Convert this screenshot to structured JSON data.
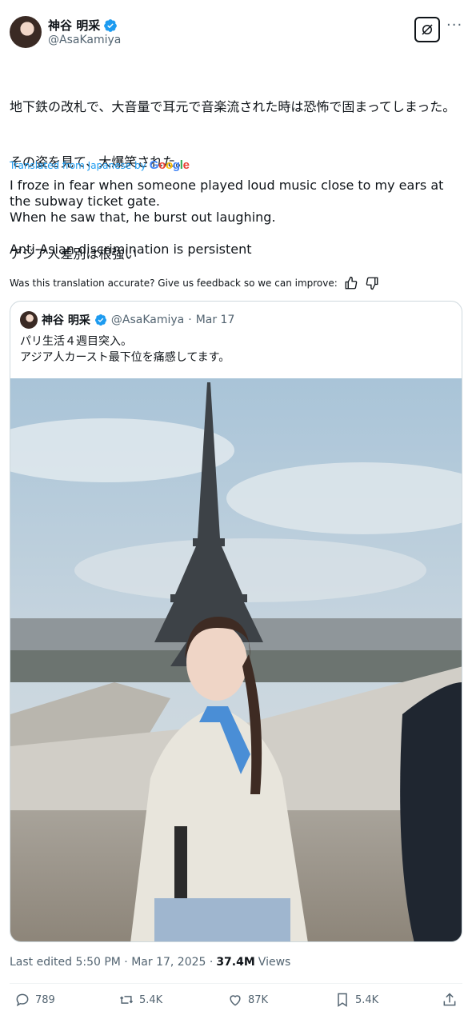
{
  "author": {
    "display_name": "神谷 明采",
    "handle": "@AsaKamiya"
  },
  "post": {
    "text_jp": [
      "地下鉄の改札で、大音量で耳元で音楽流された時は恐怖で固まってしまった。",
      "その姿を見て、大爆笑された。",
      "",
      "アジア人差別は根強い"
    ],
    "translated_label": "Translated from Japanese by",
    "translated_provider": "Google",
    "text_en": [
      "I froze in fear when someone played loud music close to my ears at the subway ticket gate.",
      "When he saw that, he burst out laughing.",
      "",
      "Anti-Asian discrimination is persistent"
    ],
    "feedback_prompt": "Was this translation accurate? Give us feedback so we can improve:"
  },
  "quote": {
    "display_name": "神谷 明采",
    "handle": "@AsaKamiya",
    "separator": "·",
    "date": "Mar 17",
    "text": "パリ生活４週目突入。\nアジア人カースト最下位を痛感してます。"
  },
  "meta": {
    "edited": "Last edited 5:50 PM · Mar 17, 2025 ·",
    "views_count": "37.4M",
    "views_label": "Views"
  },
  "actions": {
    "replies": "789",
    "reposts": "5.4K",
    "likes": "87K",
    "bookmarks": "5.4K"
  },
  "colors": {
    "accent": "#1d9bf0",
    "secondary_text": "#536471",
    "border": "#cfd9de"
  }
}
